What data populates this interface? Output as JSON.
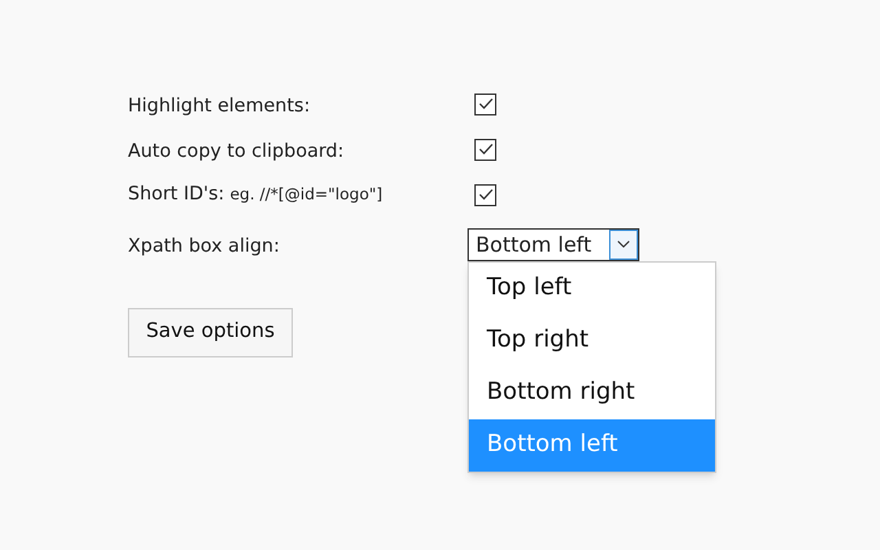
{
  "options": [
    {
      "kind": "checkbox",
      "label": "Highlight elements:",
      "checked": true
    },
    {
      "kind": "checkbox",
      "label": "Auto copy to clipboard:",
      "checked": true
    },
    {
      "kind": "checkbox",
      "label": "Short ID's:",
      "hint": "eg. //*[@id=\"logo\"]",
      "checked": true
    },
    {
      "kind": "select",
      "label": "Xpath box align:",
      "value": "Bottom left",
      "expanded": true,
      "choices": [
        {
          "label": "Top left",
          "selected": false
        },
        {
          "label": "Top right",
          "selected": false
        },
        {
          "label": "Bottom right",
          "selected": false
        },
        {
          "label": "Bottom left",
          "selected": true
        }
      ]
    }
  ],
  "save_button": "Save options"
}
